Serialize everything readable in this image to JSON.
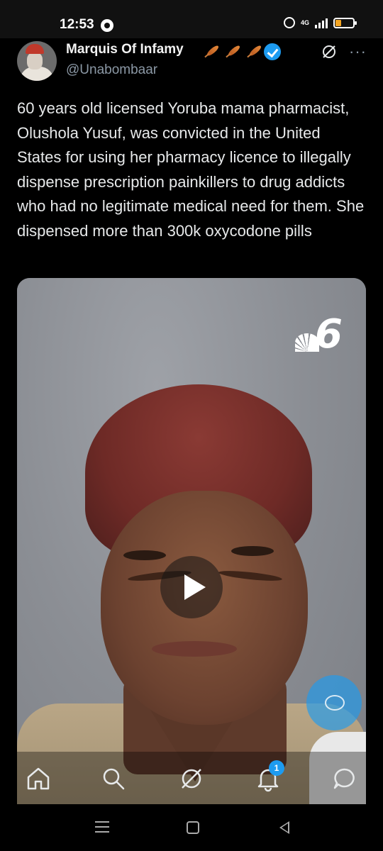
{
  "status_bar": {
    "time": "12:53",
    "network": "4G"
  },
  "tweet": {
    "display_name": "Marquis Of Infamy",
    "handle": "@Unabombaar",
    "text": "60 years old licensed Yoruba mama pharmacist, Olushola Yusuf, was convicted in the United States for using her pharmacy licence to illegally dispense prescription painkillers to drug addicts who had no legitimate medical need for them. She dispensed more than 300k oxycodone pills",
    "name_emojis": [
      "feather-icon",
      "feather-icon",
      "feather-icon"
    ],
    "verified": true,
    "more_label": "···"
  },
  "media": {
    "type": "video",
    "watermark": "6"
  },
  "bottom_nav": {
    "items": [
      "home-icon",
      "search-icon",
      "grok-icon",
      "notifications-icon",
      "messages-icon"
    ],
    "notifications_badge": "1"
  },
  "colors": {
    "accent": "#1d9bf0",
    "background": "#000000",
    "text_primary": "#e7e9ea",
    "text_secondary": "#8b98a5"
  }
}
